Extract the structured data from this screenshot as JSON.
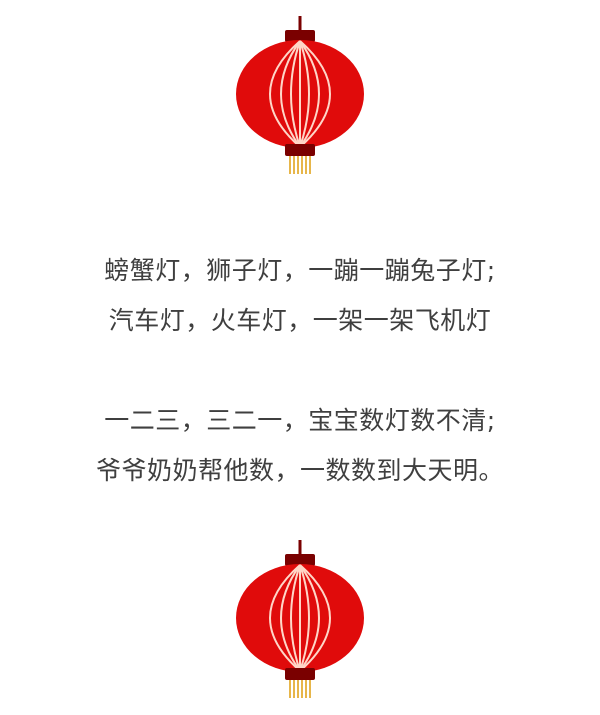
{
  "poem": {
    "stanzas": [
      {
        "lines": [
          "螃蟹灯，狮子灯，一蹦一蹦兔子灯;",
          "汽车灯，火车灯，一架一架飞机灯"
        ]
      },
      {
        "lines": [
          "一二三，三二一，宝宝数灯数不清;",
          "爷爷奶奶帮他数，一数数到大天明。"
        ]
      }
    ]
  },
  "decoration": {
    "icon": "red-lantern-icon",
    "colors": {
      "lantern_red": "#e00b0b",
      "lantern_dark": "#7a0000",
      "rib": "#ffd6c8",
      "tassel": "#e7b64a"
    }
  }
}
